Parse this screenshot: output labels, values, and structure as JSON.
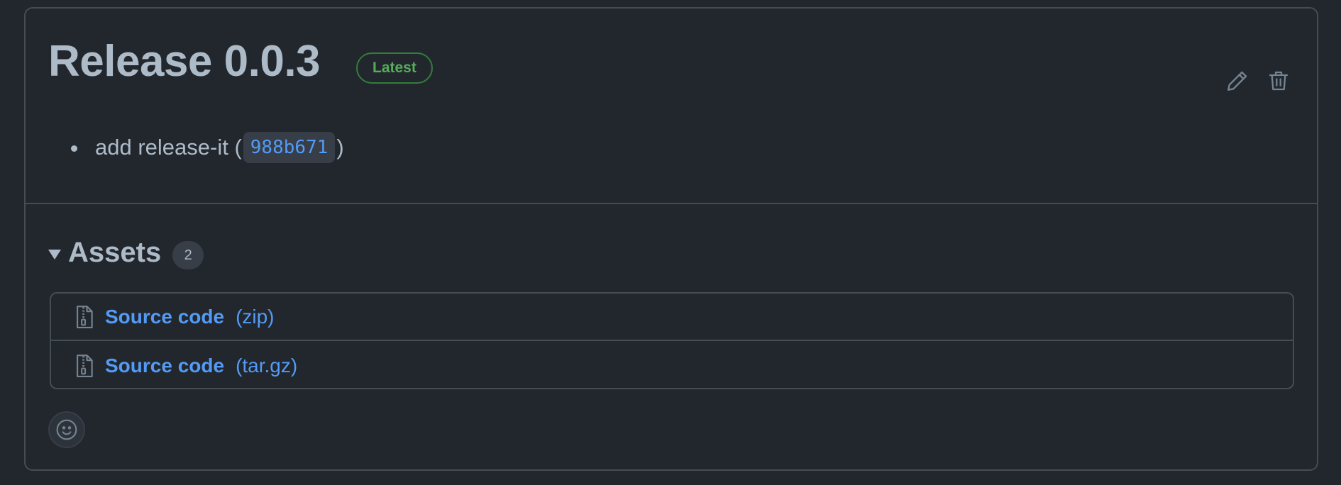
{
  "release": {
    "title": "Release 0.0.3",
    "badge": "Latest",
    "actions": {
      "edit_icon": "pencil-icon",
      "delete_icon": "trash-icon"
    },
    "notes": [
      {
        "prefix": "add release-it (",
        "commit": "988b671",
        "suffix": ")"
      }
    ]
  },
  "assets": {
    "title": "Assets",
    "count": "2",
    "items": [
      {
        "icon": "file-zip-icon",
        "name": "Source code",
        "ext": "(zip)"
      },
      {
        "icon": "file-zip-icon",
        "name": "Source code",
        "ext": "(tar.gz)"
      }
    ]
  },
  "reactions": {
    "icon": "smiley-icon"
  },
  "colors": {
    "background": "#22272e",
    "border": "#444c56",
    "text": "#adbac7",
    "link": "#539bf5",
    "success": "#57ab5a"
  }
}
